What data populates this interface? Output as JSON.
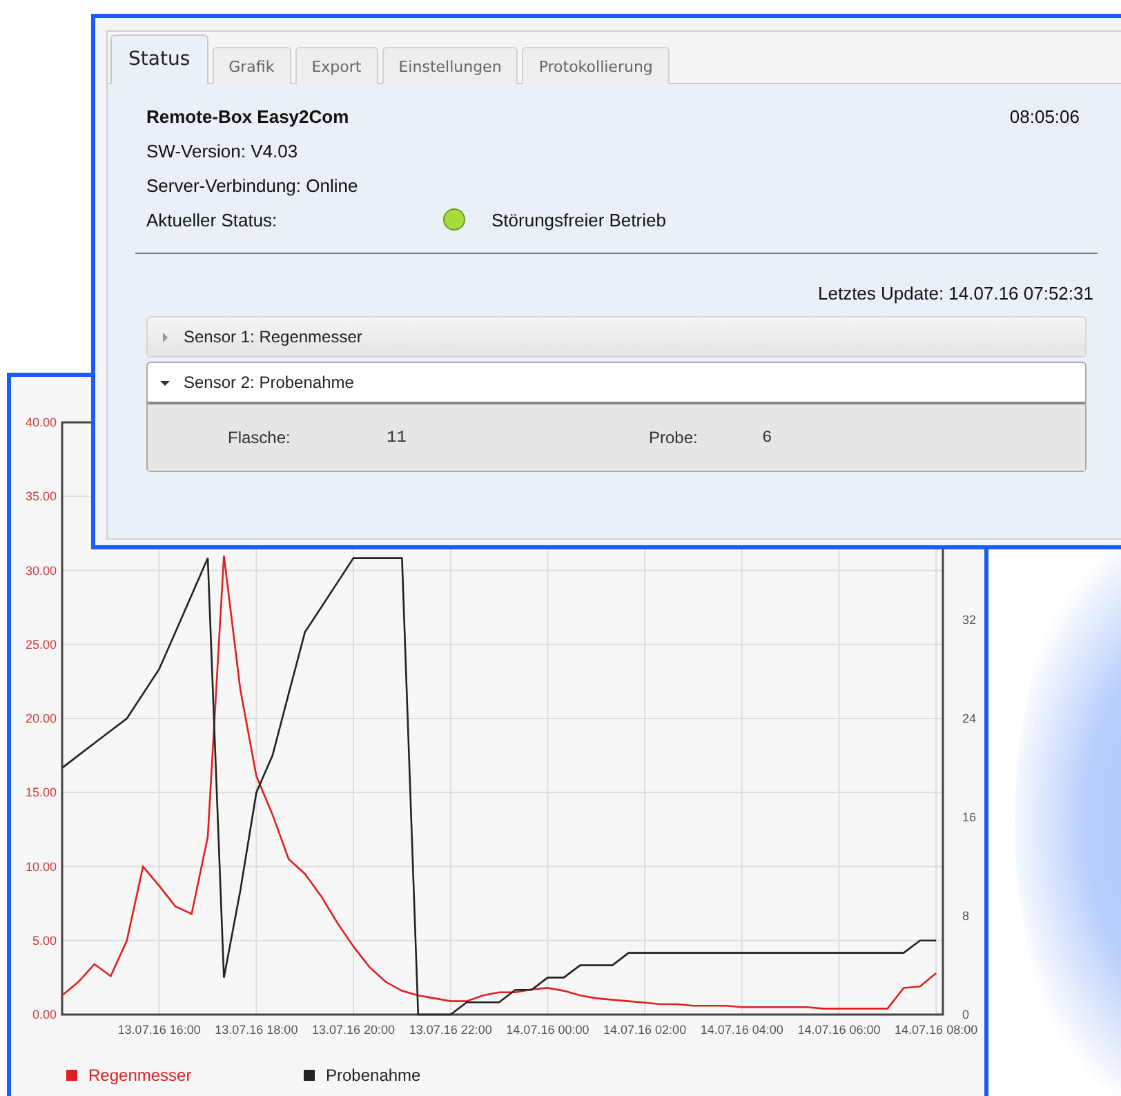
{
  "status_window": {
    "tabs": [
      {
        "label": "Status",
        "selected": true
      },
      {
        "label": "Grafik",
        "selected": false
      },
      {
        "label": "Export",
        "selected": false
      },
      {
        "label": "Einstellungen",
        "selected": false
      },
      {
        "label": "Protokollierung",
        "selected": false
      }
    ],
    "device_name": "Remote-Box Easy2Com",
    "time": "08:05:06",
    "sw_version": "SW-Version: V4.03",
    "server_connection": "Server-Verbindung: Online",
    "status": {
      "label": "Aktueller Status:",
      "color": "#a6dc3c",
      "text": "Störungsfreier Betrieb"
    },
    "last_update": "Letztes Update: 14.07.16 07:52:31",
    "sensors": [
      {
        "title": "Sensor 1: Regenmesser",
        "expanded": false
      },
      {
        "title": "Sensor 2: Probenahme",
        "expanded": true,
        "fields": [
          {
            "label": "Flasche:",
            "value": "11"
          },
          {
            "label": "Probe:",
            "value": "6"
          }
        ]
      }
    ]
  },
  "chart_window": {
    "chart_data": {
      "type": "line",
      "categories": [
        null,
        null,
        null,
        null,
        null,
        null,
        "13.07.16 16:00",
        null,
        null,
        null,
        null,
        null,
        "13.07.16 18:00",
        null,
        null,
        null,
        null,
        null,
        "13.07.16 20:00",
        null,
        null,
        null,
        null,
        null,
        "13.07.16 22:00",
        null,
        null,
        null,
        null,
        null,
        "14.07.16 00:00",
        null,
        null,
        null,
        null,
        null,
        "14.07.16 02:00",
        null,
        null,
        null,
        null,
        null,
        "14.07.16 04:00",
        null,
        null,
        null,
        null,
        null,
        "14.07.16 06:00",
        null,
        null,
        null,
        null,
        null,
        "14.07.16 08:00"
      ],
      "grid": true,
      "legend": true,
      "ylim": [
        0,
        40
      ],
      "y2lim": [
        0,
        48
      ],
      "yticks": [
        {
          "value": 0,
          "label": "0.00"
        },
        {
          "value": 5,
          "label": "5.00"
        },
        {
          "value": 10,
          "label": "10.00"
        },
        {
          "value": 15,
          "label": "15.00"
        },
        {
          "value": 20,
          "label": "20.00"
        },
        {
          "value": 25,
          "label": "25.00"
        },
        {
          "value": 30,
          "label": "30.00"
        },
        {
          "value": 35,
          "label": "35.00"
        },
        {
          "value": 40,
          "label": "40.00"
        }
      ],
      "y2ticks": [
        0,
        8,
        16,
        24,
        32
      ],
      "series": [
        {
          "name": "Regenmesser",
          "color": "#e02020",
          "values": [
            1.3,
            2.2,
            3.4,
            2.6,
            5,
            10,
            8.7,
            7.3,
            6.8,
            12,
            31,
            22,
            16.1,
            13.5,
            10.5,
            9.5,
            8.0,
            6.2,
            4.6,
            3.2,
            2.2,
            1.6,
            1.3,
            1.1,
            0.9,
            0.9,
            1.3,
            1.5,
            1.5,
            1.7,
            1.8,
            1.6,
            1.3,
            1.1,
            1.0,
            0.9,
            0.8,
            0.7,
            0.7,
            0.6,
            0.6,
            0.6,
            0.5,
            0.5,
            0.5,
            0.5,
            0.5,
            0.4,
            0.4,
            0.4,
            0.4,
            0.4,
            1.8,
            1.9,
            2.8
          ]
        },
        {
          "name": "Probenahme",
          "color": "#222222",
          "axis": "y2",
          "values": [
            20,
            21,
            22,
            23,
            24,
            26,
            28,
            31,
            34,
            37,
            3,
            10,
            18,
            21,
            26,
            31,
            33,
            35,
            37,
            37,
            37,
            37,
            0,
            0,
            0,
            1,
            1,
            1,
            2,
            2,
            3,
            3,
            4,
            4,
            4,
            5,
            5,
            5,
            5,
            5,
            5,
            5,
            5,
            5,
            5,
            5,
            5,
            5,
            5,
            5,
            5,
            5,
            5,
            6,
            6
          ]
        }
      ]
    }
  }
}
